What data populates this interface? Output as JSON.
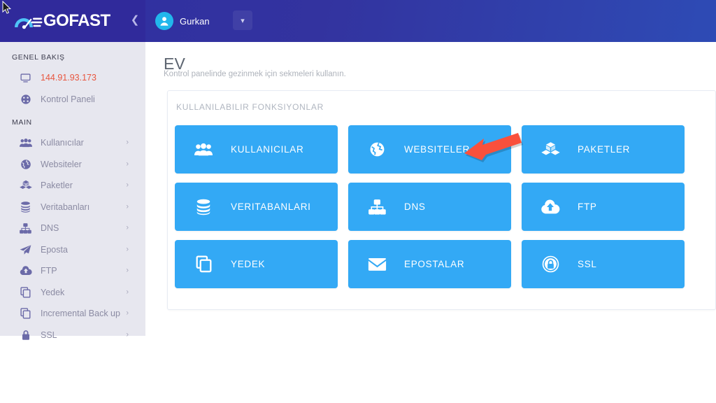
{
  "brand": {
    "logo_text": "GOFAST",
    "logo_icon": "speedometer-icon",
    "collapse_icon": "chevron-left-icon",
    "header_bg": "#2f2fa2",
    "logo_bg": "#302a9b"
  },
  "header": {
    "user_name": "Gurkan",
    "avatar_icon": "user-avatar-icon",
    "caret_icon": "chevron-down-icon"
  },
  "sidebar": {
    "sections": [
      {
        "label": "GENEL BAKIŞ",
        "items": [
          {
            "label": "144.91.93.173",
            "icon": "monitor-icon",
            "highlight": true,
            "chevron": false
          },
          {
            "label": "Kontrol Paneli",
            "icon": "dashboard-gauge-icon",
            "highlight": false,
            "chevron": false
          }
        ]
      },
      {
        "label": "MAIN",
        "items": [
          {
            "label": "Kullanıcılar",
            "icon": "users-icon",
            "highlight": false,
            "chevron": true
          },
          {
            "label": "Websiteler",
            "icon": "globe-icon",
            "highlight": false,
            "chevron": true
          },
          {
            "label": "Paketler",
            "icon": "packages-icon",
            "highlight": false,
            "chevron": true
          },
          {
            "label": "Veritabanları",
            "icon": "database-icon",
            "highlight": false,
            "chevron": true
          },
          {
            "label": "DNS",
            "icon": "sitemap-icon",
            "highlight": false,
            "chevron": true
          },
          {
            "label": "Eposta",
            "icon": "paper-plane-icon",
            "highlight": false,
            "chevron": true
          },
          {
            "label": "FTP",
            "icon": "cloud-upload-icon",
            "highlight": false,
            "chevron": true
          },
          {
            "label": "Yedek",
            "icon": "copy-icon",
            "highlight": false,
            "chevron": true
          },
          {
            "label": "Incremental Back up",
            "icon": "copy-icon",
            "highlight": false,
            "chevron": true
          },
          {
            "label": "SSL",
            "icon": "lock-icon",
            "highlight": false,
            "chevron": true
          }
        ]
      }
    ],
    "chevron_icon": "chevron-right-icon",
    "ip_color": "#e8563f",
    "bg": "#e7e7ef"
  },
  "main": {
    "page_title": "EV",
    "page_subtitle": "Kontrol panelinde gezinmek için sekmeleri kullanın.",
    "card_title": "KULLANILABILIR FONKSIYONLAR",
    "tile_color": "#33a9f5",
    "tiles": [
      {
        "label": "KULLANICILAR",
        "icon": "users-icon"
      },
      {
        "label": "WEBSITELER",
        "icon": "globe-icon"
      },
      {
        "label": "PAKETLER",
        "icon": "packages-icon"
      },
      {
        "label": "VERITABANLARI",
        "icon": "database-icon"
      },
      {
        "label": "DNS",
        "icon": "sitemap-icon"
      },
      {
        "label": "FTP",
        "icon": "cloud-upload-icon"
      },
      {
        "label": "YEDEK",
        "icon": "copy-icon"
      },
      {
        "label": "EPOSTALAR",
        "icon": "envelope-icon"
      },
      {
        "label": "SSL",
        "icon": "lock-circle-icon"
      }
    ]
  },
  "annotation": {
    "arrow_icon": "red-pointer-arrow",
    "arrow_color": "#f9503c",
    "arrow_target": "WEBSITELER",
    "cursor_icon": "mouse-cursor-icon"
  }
}
